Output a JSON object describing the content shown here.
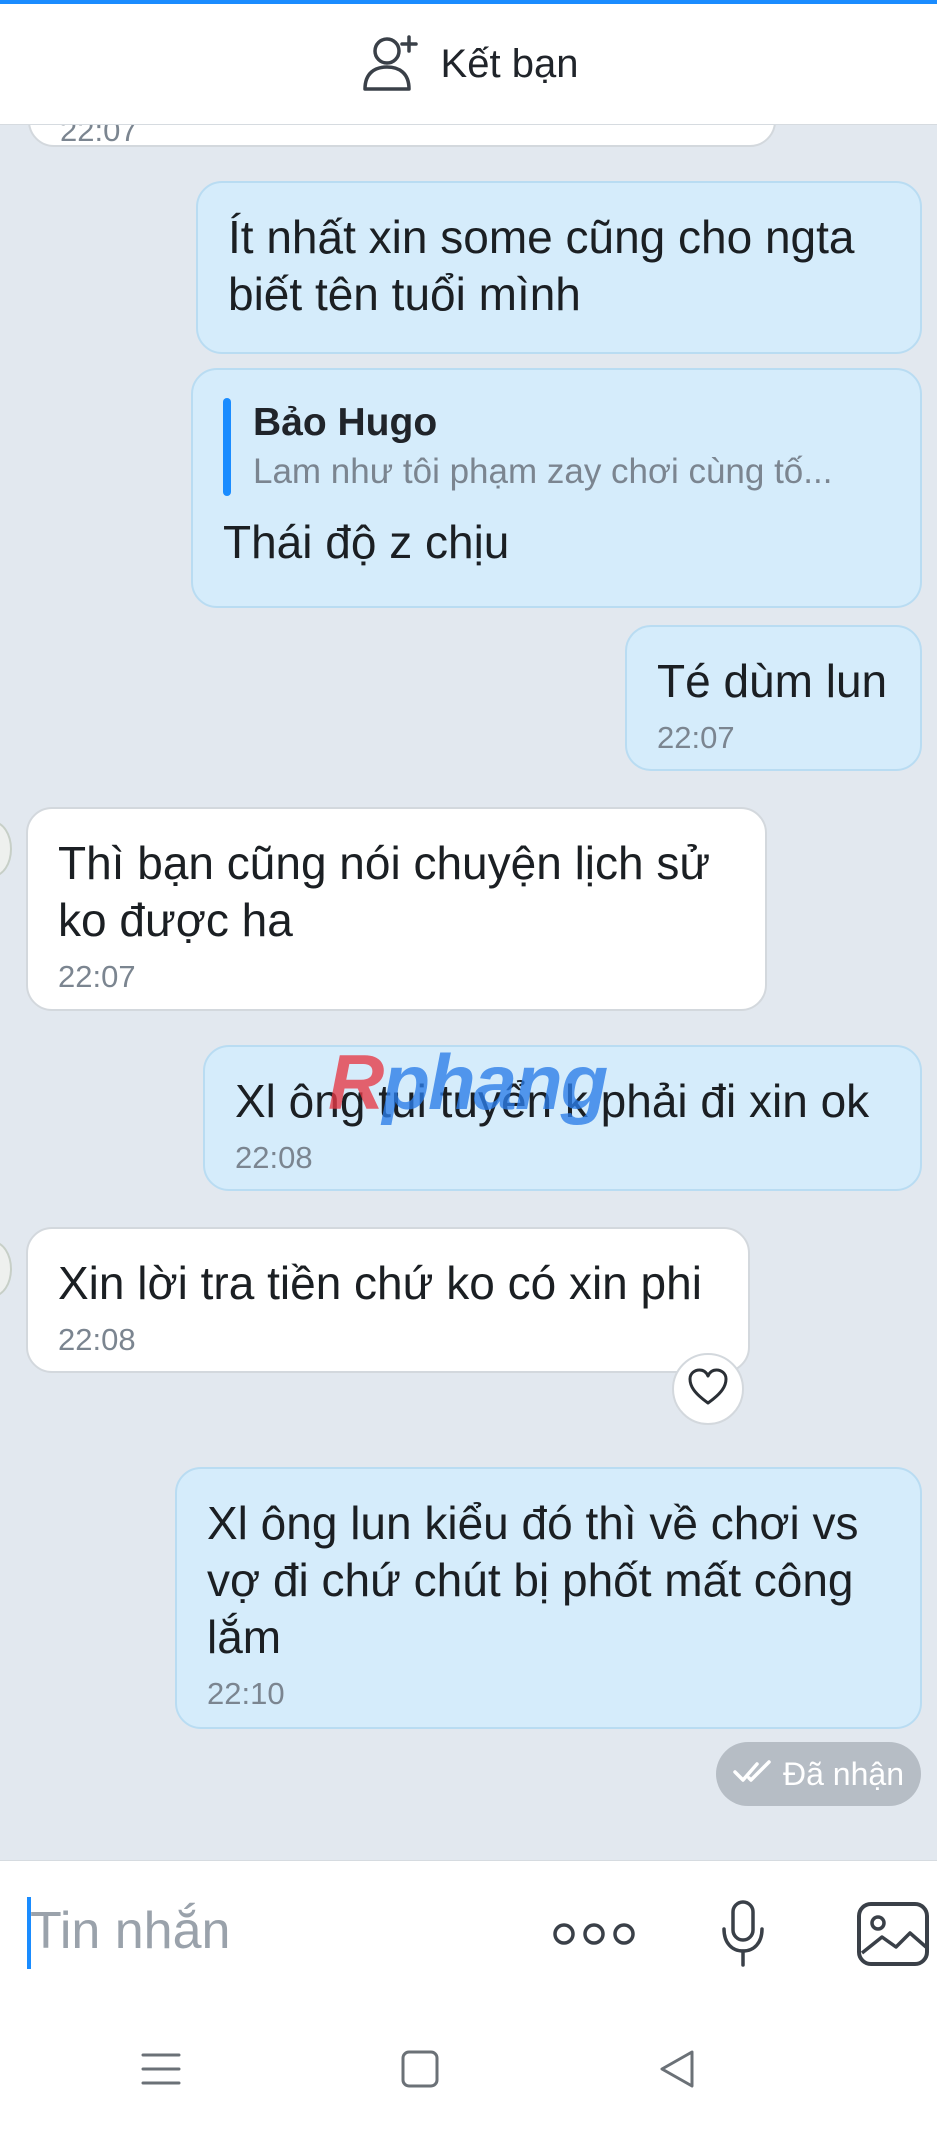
{
  "header": {
    "add_friend_label": "Kết bạn"
  },
  "partial_top_time": "22:07",
  "messages": [
    {
      "text": "Ít nhất xin some cũng cho ngta\nbiết tên tuổi mình"
    },
    {
      "quote_name": "Bảo Hugo",
      "quote_text": "Lam như tôi phạm zay chơi cùng tố...",
      "text": "Thái độ z chịu"
    },
    {
      "text": "Té dùm lun",
      "time": "22:07"
    },
    {
      "text": "Thì bạn cũng nói chuyện lịch sử\nko được ha",
      "time": "22:07"
    },
    {
      "text": "Xl ông tui tuyển k phải đi xin ok",
      "time": "22:08"
    },
    {
      "text": "Xin lời tra tiền chứ ko có xin phi",
      "time": "22:08"
    },
    {
      "text": "Xl ông lun kiểu đó thì về chơi vs\nvợ đi chứ chút bị phốt mất công\nlắm",
      "time": "22:10"
    }
  ],
  "status": {
    "label": "Đã nhận"
  },
  "watermark": {
    "part1": "R",
    "part2": "phang"
  },
  "input": {
    "placeholder": "Tin nhắn"
  },
  "colors": {
    "accent": "#1a8cff",
    "outgoing_bubble": "#d5ecfb",
    "incoming_bubble": "#ffffff",
    "background": "#e2e8ef"
  },
  "icons": [
    "add-friend-icon",
    "heart-icon",
    "double-check-icon",
    "more-icon",
    "microphone-icon",
    "image-icon",
    "menu-icon",
    "home-icon",
    "back-icon"
  ]
}
